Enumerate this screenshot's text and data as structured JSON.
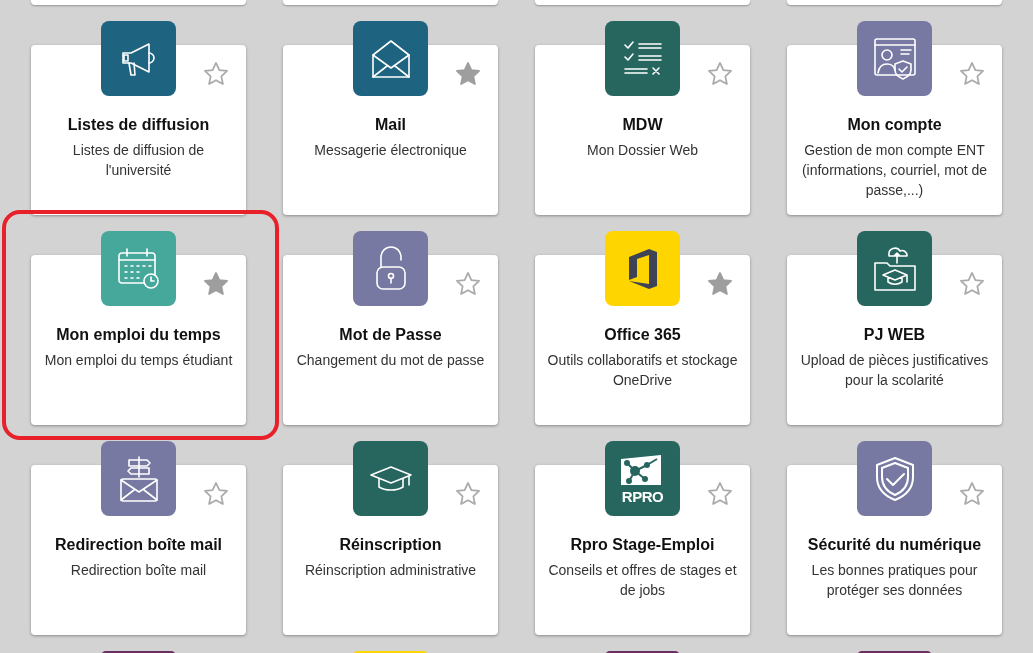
{
  "apps": [
    {
      "title": "Listes de diffusion",
      "description": "Listes de diffusion de l'université",
      "color": "#1e6480",
      "favorite": false,
      "highlighted": false
    },
    {
      "title": "Mail",
      "description": "Messagerie électronique",
      "color": "#1e6480",
      "favorite": true,
      "highlighted": false
    },
    {
      "title": "MDW",
      "description": "Mon Dossier Web",
      "color": "#27665f",
      "favorite": false,
      "highlighted": false
    },
    {
      "title": "Mon compte",
      "description": "Gestion de mon compte ENT (informations, courriel, mot de passe,...)",
      "color": "#7779a3",
      "favorite": false,
      "highlighted": false
    },
    {
      "title": "Mon emploi du temps",
      "description": "Mon emploi du temps étudiant",
      "color": "#45a89a",
      "favorite": true,
      "highlighted": true
    },
    {
      "title": "Mot de Passe",
      "description": "Changement du mot de passe",
      "color": "#7779a3",
      "favorite": false,
      "highlighted": false
    },
    {
      "title": "Office 365",
      "description": "Outils collaboratifs et stockage OneDrive",
      "color": "#ffd500",
      "favorite": true,
      "highlighted": false
    },
    {
      "title": "PJ WEB",
      "description": "Upload de pièces justificatives pour la scolarité",
      "color": "#27665f",
      "favorite": false,
      "highlighted": false
    },
    {
      "title": "Redirection boîte mail",
      "description": "Redirection boîte mail",
      "color": "#7779a3",
      "favorite": false,
      "highlighted": false
    },
    {
      "title": "Réinscription",
      "description": "Réinscription administrative",
      "color": "#27665f",
      "favorite": false,
      "highlighted": false
    },
    {
      "title": "Rpro Stage-Emploi",
      "description": "Conseils et offres de stages et de jobs",
      "icon_text": "RPRO",
      "color": "#27665f",
      "favorite": false,
      "highlighted": false
    },
    {
      "title": "Sécurité du numérique",
      "description": "Les bonnes pratiques pour protéger ses données",
      "color": "#7779a3",
      "favorite": false,
      "highlighted": false
    }
  ],
  "cut_tiles": [
    {
      "color": "#6b2f5f"
    },
    {
      "color": "#ffd500"
    },
    {
      "color": "#6b2f5f"
    },
    {
      "color": "#6b2f5f"
    }
  ]
}
